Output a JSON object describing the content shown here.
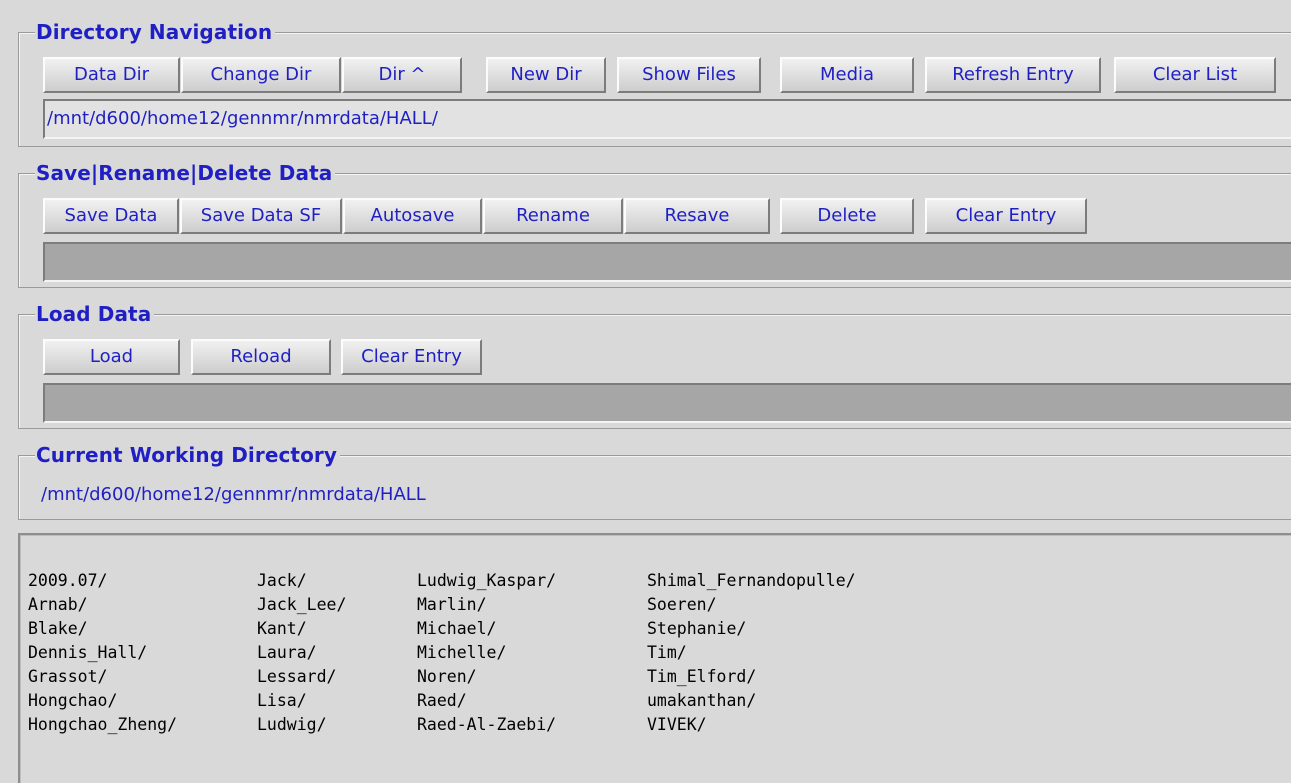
{
  "directory_navigation": {
    "title": "Directory Navigation",
    "buttons": [
      "Data Dir",
      "Change Dir",
      "Dir ^",
      "New Dir",
      "Show Files",
      "Media",
      "Refresh Entry",
      "Clear List"
    ],
    "path_value": "/mnt/d600/home12/gennmr/nmrdata/HALL/"
  },
  "save_section": {
    "title": "Save|Rename|Delete Data",
    "buttons": [
      "Save Data",
      "Save Data SF",
      "Autosave",
      "Rename",
      "Resave",
      "Delete",
      "Clear Entry"
    ],
    "entry_value": ""
  },
  "load_section": {
    "title": "Load Data",
    "buttons": [
      "Load",
      "Reload",
      "Clear Entry"
    ],
    "entry_value": ""
  },
  "current_working_directory": {
    "title": "Current Working Directory",
    "path": "/mnt/d600/home12/gennmr/nmrdata/HALL"
  },
  "file_listing": {
    "columns": [
      [
        "2009.07/",
        "Arnab/",
        "Blake/",
        "Dennis_Hall/",
        "Grassot/",
        "Hongchao/",
        "Hongchao_Zheng/"
      ],
      [
        "Jack/",
        "Jack_Lee/",
        "Kant/",
        "Laura/",
        "Lessard/",
        "Lisa/",
        "Ludwig/"
      ],
      [
        "Ludwig_Kaspar/",
        "Marlin/",
        "Michael/",
        "Michelle/",
        "Noren/",
        "Raed/",
        "Raed-Al-Zaebi/"
      ],
      [
        "Shimal_Fernandopulle/",
        "Soeren/",
        "Stephanie/",
        "Tim/",
        "Tim_Elford/",
        "umakanthan/",
        "VIVEK/"
      ]
    ]
  },
  "colors": {
    "label_blue": "#1f1fc4",
    "background": "#d9d9d9"
  }
}
